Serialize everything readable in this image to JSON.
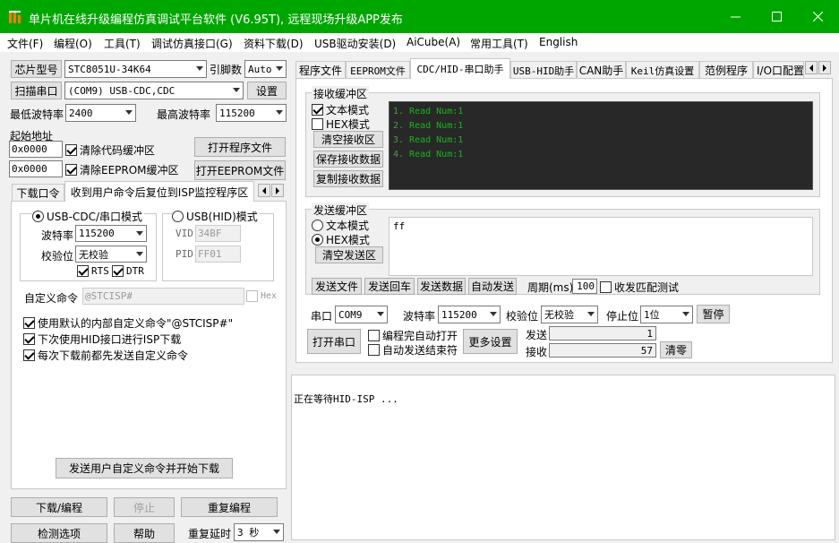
{
  "window": {
    "title": "单片机在线升级编程仿真调试平台软件 (V6.95T), 远程现场升级APP发布",
    "app_icon": "stc-chip-icon",
    "controls": {
      "minimize": "—",
      "maximize": "☐",
      "close": "✕"
    },
    "accent": "#00a600"
  },
  "menu": [
    "文件(F)",
    "编程(O)",
    "工具(T)",
    "调试仿真接口(G)",
    "资料下载(D)",
    "USB驱动安装(D)",
    "AiCube(A)",
    "常用工具(T)",
    "English"
  ],
  "left": {
    "chip_button": "芯片型号",
    "chip_value": "STC8051U-34K64",
    "pins_label": "引脚数",
    "pins_value": "Auto",
    "scan_button": "扫描串口",
    "port_value": "(COM9) USB-CDC,CDC",
    "settings_button": "设置",
    "min_baud_label": "最低波特率",
    "min_baud_value": "2400",
    "max_baud_label": "最高波特率",
    "max_baud_value": "115200",
    "start_addr_label": "起始地址",
    "addr1": "0x0000",
    "clear_code_label": "清除代码缓冲区",
    "open_prog_button": "打开程序文件",
    "addr2": "0x0000",
    "clear_eeprom_label": "清除EEPROM缓冲区",
    "open_eeprom_button": "打开EEPROM文件",
    "tabs": [
      "下载口令",
      "收到用户命令后复位到ISP监控程序区"
    ],
    "cdc_radio": "USB-CDC/串口模式",
    "hid_radio": "USB(HID)模式",
    "baud_label": "波特率",
    "baud_value": "115200",
    "parity_label": "校验位",
    "parity_value": "无校验",
    "rts_label": "RTS",
    "dtr_label": "DTR",
    "vid_label": "VID",
    "vid_value": "34BF",
    "pid_label": "PID",
    "pid_value": "FF01",
    "custom_cmd_label": "自定义命令",
    "custom_cmd_value": "@STCISP#",
    "hex_label": "Hex",
    "opt1": "使用默认的内部自定义命令\"@STCISP#\"",
    "opt2": "下次使用HID接口进行ISP下载",
    "opt3": "每次下载前都先发送自定义命令",
    "send_cmd_button": "发送用户自定义命令并开始下载",
    "download_button": "下载/编程",
    "stop_button": "停止",
    "repeat_button": "重复编程",
    "check_button": "检测选项",
    "help_button": "帮助",
    "repeat_delay_label": "重复延时",
    "repeat_delay_value": "3 秒"
  },
  "right": {
    "tabs": [
      "程序文件",
      "EEPROM文件",
      "CDC/HID-串口助手",
      "USB-HID助手",
      "CAN助手",
      "Keil仿真设置",
      "范例程序",
      "I/O口配置"
    ],
    "recv_group": "接收缓冲区",
    "recv_text_mode": "文本模式",
    "recv_hex_mode": "HEX模式",
    "clear_recv": "清空接收区",
    "save_recv": "保存接收数据",
    "copy_recv": "复制接收数据",
    "recv_lines": [
      "Read Num:1",
      "Read Num:1",
      "Read Num:1",
      "Read Num:1"
    ],
    "recv_line_numbers": [
      "1.",
      "2.",
      "3.",
      "4."
    ],
    "send_group": "发送缓冲区",
    "send_text_mode": "文本模式",
    "send_hex_mode": "HEX模式",
    "clear_send": "清空发送区",
    "send_content": "ff",
    "send_file": "发送文件",
    "send_enter": "发送回车",
    "send_data": "发送数据",
    "auto_send": "自动发送",
    "period_label": "周期(ms)",
    "period_value": "100",
    "recv_match_label": "收发匹配测试",
    "port_label": "串口",
    "port_value": "COM9",
    "baud_label": "波特率",
    "baud_value": "115200",
    "parity_label": "校验位",
    "parity_value": "无校验",
    "stop_label": "停止位",
    "stop_value": "1位",
    "pause_button": "暂停",
    "open_port_button": "打开串口",
    "auto_open_label": "编程完自动打开",
    "auto_end_label": "自动发送结束符",
    "more_settings": "更多设置",
    "sent_label": "发送",
    "sent_value": "1",
    "recv_label": "接收",
    "recv_value": "57",
    "clear_counts": "清零"
  },
  "log": {
    "text": "正在等待HID-ISP ..."
  }
}
